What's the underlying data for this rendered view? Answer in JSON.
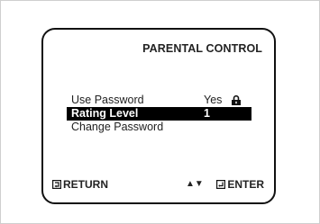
{
  "menu": {
    "title": "PARENTAL CONTROL",
    "items": [
      {
        "label": "Use Password",
        "value": "Yes",
        "icon": "lock-icon"
      },
      {
        "label": "Rating Level",
        "value": "1",
        "selected": true
      },
      {
        "label": "Change Password",
        "value": ""
      }
    ]
  },
  "footer": {
    "return_label": "RETURN",
    "return_icon": "return-icon",
    "updown_label": "▲▼",
    "enter_label": "ENTER",
    "enter_icon": "enter-icon"
  },
  "colors": {
    "highlight": "#000000",
    "text": "#222222",
    "border": "#111111"
  }
}
